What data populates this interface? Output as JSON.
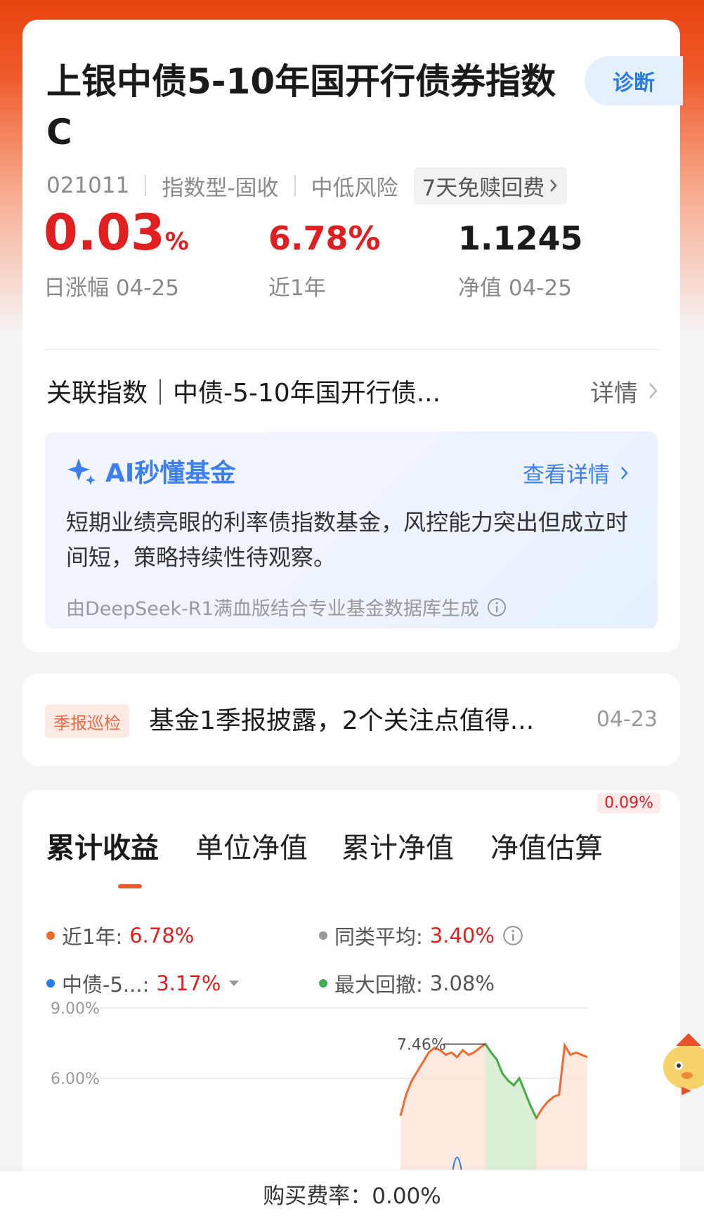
{
  "fund": {
    "title": "上银中债5-10年国开行债券指数C",
    "diagnose_label": "诊断",
    "code": "021011",
    "type": "指数型-固收",
    "risk": "中低风险",
    "fee_tag": "7天免赎回费",
    "stats": {
      "daily_change_value": "0.03",
      "daily_change_unit": "%",
      "daily_change_label": "日涨幅 04-25",
      "year_return_value": "6.78%",
      "year_return_label": "近1年",
      "nav_value": "1.1245",
      "nav_label": "净值 04-25"
    },
    "linked_index_text": "关联指数｜中债-5-10年国开行债...",
    "linked_index_more": "详情"
  },
  "ai": {
    "title": "AI秒懂基金",
    "more_label": "查看详情",
    "summary": "短期业绩亮眼的利率债指数基金，风控能力突出但成立时间短，策略持续性待观察。",
    "footnote": "由DeepSeek-R1满血版结合专业基金数据库生成"
  },
  "report": {
    "tag": "季报巡检",
    "text": "基金1季报披露，2个关注点值得...",
    "date": "04-23"
  },
  "chart_tabs": {
    "tabs": [
      "累计收益",
      "单位净值",
      "累计净值",
      "净值估算"
    ],
    "active_index": 0,
    "estimate_badge": "0.09%"
  },
  "legend": {
    "year_label": "近1年:",
    "year_value": "6.78%",
    "peer_label": "同类平均:",
    "peer_value": "3.40%",
    "index_label": "中债-5...:",
    "index_value": "3.17%",
    "drawdown_label": "最大回撤:",
    "drawdown_value": "3.08%"
  },
  "colors": {
    "accent": "#ef5a2a",
    "up": "#e02020",
    "fund_line": "#f06a30",
    "index_line": "#2b7be6",
    "peer_line": "#999999",
    "drawdown": "#3fb04a",
    "ai_blue": "#3d7ff0"
  },
  "chart_data": {
    "type": "line",
    "y_tick_labels": [
      "9.00%",
      "6.00%"
    ],
    "ylim": [
      0,
      9
    ],
    "x": [
      0,
      3,
      6,
      9,
      12,
      15,
      18,
      21,
      24,
      27,
      30,
      33,
      36,
      39,
      42,
      45,
      48,
      51,
      54,
      57,
      60,
      63,
      66,
      69,
      72,
      75,
      78,
      81,
      84,
      87,
      90,
      93,
      96,
      99
    ],
    "series": [
      {
        "name": "近1年",
        "values": [
          4.4,
          5.3,
          5.9,
          6.3,
          6.7,
          7.1,
          7.3,
          7.2,
          7.0,
          7.1,
          6.9,
          7.2,
          7.0,
          7.1,
          7.3,
          7.46,
          7.1,
          6.8,
          6.2,
          5.9,
          5.7,
          6.0,
          5.4,
          4.8,
          4.3,
          4.7,
          5.0,
          5.2,
          5.3,
          7.4,
          7.0,
          7.1,
          7.0,
          6.9
        ]
      }
    ],
    "annotations": [
      {
        "label": "7.46%",
        "value": 7.46
      }
    ],
    "drawdown_range": [
      45,
      72
    ],
    "grid": true
  },
  "bottom": {
    "fee_text": "购买费率：0.00%"
  }
}
